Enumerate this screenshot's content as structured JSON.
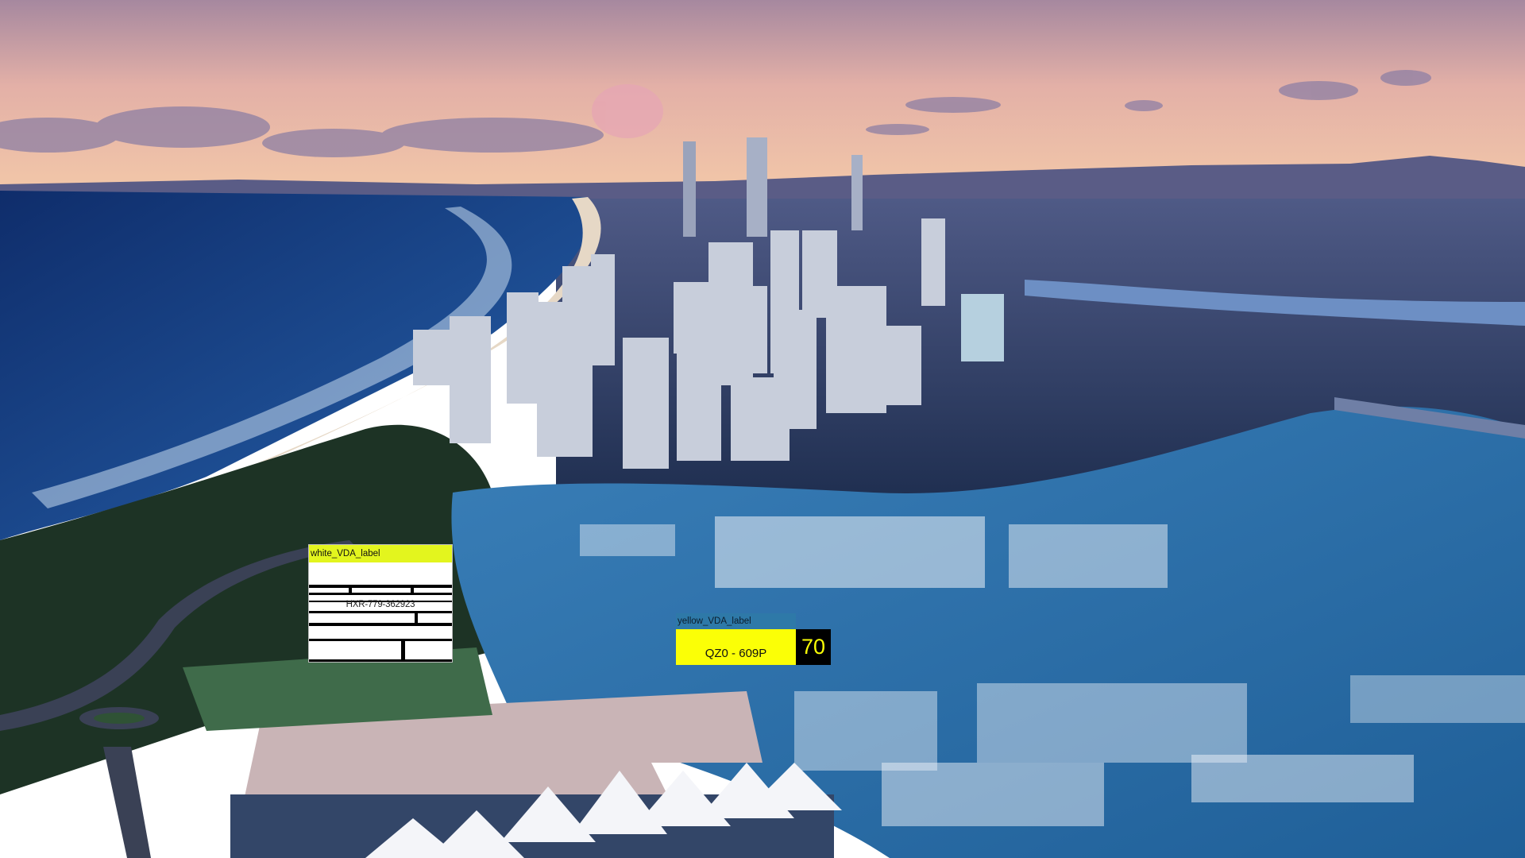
{
  "scene": {
    "description_tags": [
      "sky-gradient",
      "ocean",
      "beach",
      "skyline",
      "marina",
      "boats",
      "mountains"
    ],
    "colors": {
      "sky_top": "#a6889f",
      "sky_mid": "#e3b0a7",
      "sky_horizon": "#f2c7a8",
      "ocean_deep": "#0f2d6b",
      "ocean_mid": "#1d4d92",
      "surf": "#c9dcf0",
      "sand": "#e6d8c6",
      "land": "#274063",
      "vegetation": "#1d3325",
      "marina_water": "#2c6fa6",
      "tower": "#c8cedb"
    }
  },
  "labels": {
    "white": {
      "title": "white_VDA_label",
      "code": "HXR-779-362923",
      "header_color": "#e3f51e"
    },
    "yellow": {
      "title": "yellow_VDA_label",
      "plate": "QZ0 - 609P",
      "number": "70",
      "plate_color": "#fbff06",
      "header_color": "#2e79a8"
    }
  }
}
